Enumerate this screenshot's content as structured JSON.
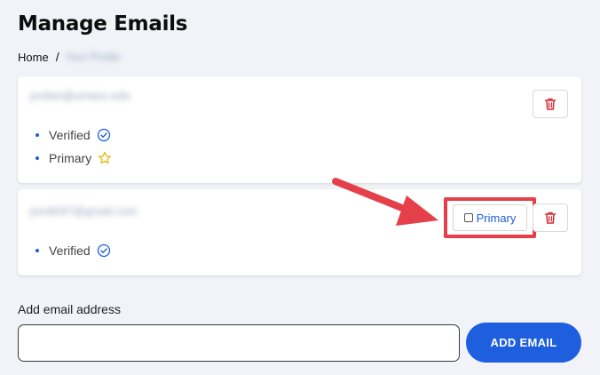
{
  "page": {
    "title": "Manage Emails"
  },
  "breadcrumb": {
    "home": "Home",
    "separator": "/",
    "current": "Your Profile"
  },
  "emails": [
    {
      "address": "jordan@umass.edu",
      "statuses": [
        "Verified",
        "Primary"
      ]
    },
    {
      "address": "jsmith97@gmail.com",
      "statuses": [
        "Verified"
      ],
      "make_primary_label": "Primary"
    }
  ],
  "add_email": {
    "label": "Add email address",
    "input_value": "",
    "button_label": "ADD EMAIL"
  },
  "colors": {
    "accent": "#1e5fe0",
    "delete": "#d42b35",
    "highlight": "#e53f4a",
    "star": "#e6b400",
    "background": "#f1f3f8"
  },
  "icons": {
    "verified": "check-circle-icon",
    "primary": "star-icon",
    "delete": "trash-icon",
    "pointer": "arrow-icon"
  }
}
